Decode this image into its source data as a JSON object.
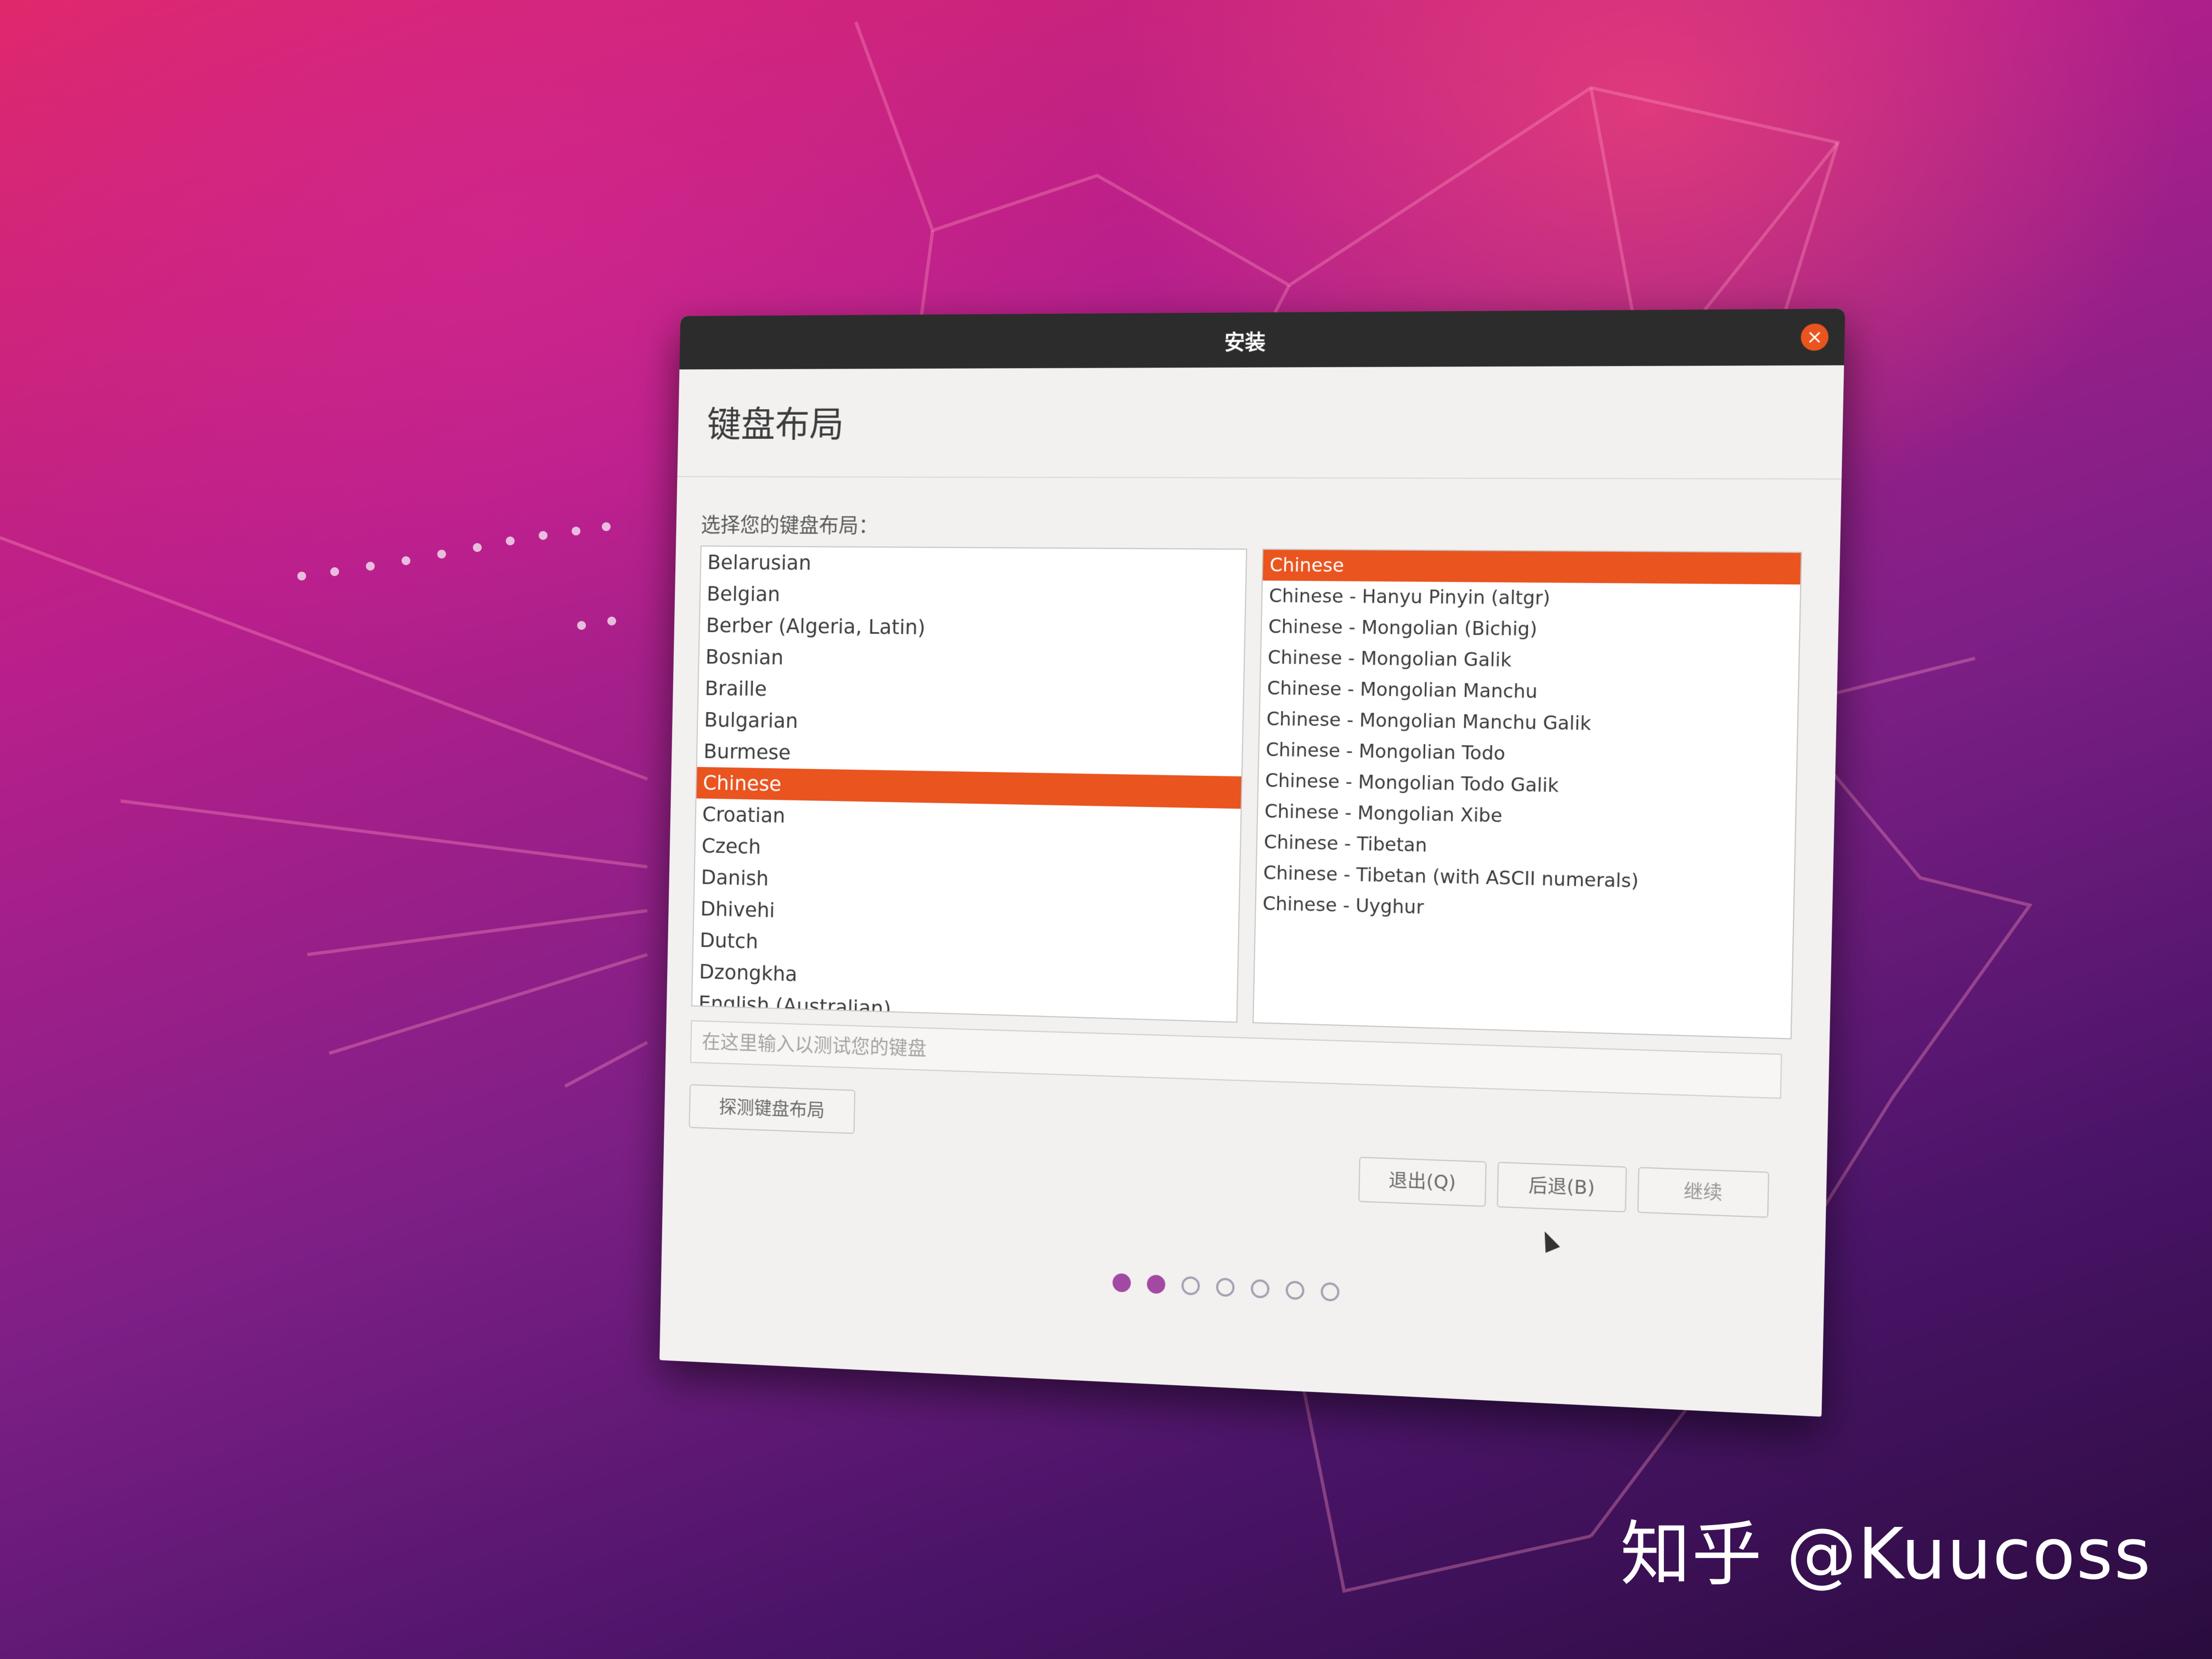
{
  "window": {
    "title": "安装",
    "close_icon": "close-icon"
  },
  "page": {
    "heading": "键盘布局",
    "prompt": "选择您的键盘布局："
  },
  "layouts": {
    "items": [
      {
        "label": "Belarusian",
        "selected": false
      },
      {
        "label": "Belgian",
        "selected": false
      },
      {
        "label": "Berber (Algeria, Latin)",
        "selected": false
      },
      {
        "label": "Bosnian",
        "selected": false
      },
      {
        "label": "Braille",
        "selected": false
      },
      {
        "label": "Bulgarian",
        "selected": false
      },
      {
        "label": "Burmese",
        "selected": false
      },
      {
        "label": "Chinese",
        "selected": true
      },
      {
        "label": "Croatian",
        "selected": false
      },
      {
        "label": "Czech",
        "selected": false
      },
      {
        "label": "Danish",
        "selected": false
      },
      {
        "label": "Dhivehi",
        "selected": false
      },
      {
        "label": "Dutch",
        "selected": false
      },
      {
        "label": "Dzongkha",
        "selected": false
      },
      {
        "label": "English (Australian)",
        "selected": false
      }
    ]
  },
  "variants": {
    "items": [
      {
        "label": "Chinese",
        "selected": true
      },
      {
        "label": "Chinese - Hanyu Pinyin (altgr)",
        "selected": false
      },
      {
        "label": "Chinese - Mongolian (Bichig)",
        "selected": false
      },
      {
        "label": "Chinese - Mongolian Galik",
        "selected": false
      },
      {
        "label": "Chinese - Mongolian Manchu",
        "selected": false
      },
      {
        "label": "Chinese - Mongolian Manchu Galik",
        "selected": false
      },
      {
        "label": "Chinese - Mongolian Todo",
        "selected": false
      },
      {
        "label": "Chinese - Mongolian Todo Galik",
        "selected": false
      },
      {
        "label": "Chinese - Mongolian Xibe",
        "selected": false
      },
      {
        "label": "Chinese - Tibetan",
        "selected": false
      },
      {
        "label": "Chinese - Tibetan (with ASCII numerals)",
        "selected": false
      },
      {
        "label": "Chinese - Uyghur",
        "selected": false
      }
    ]
  },
  "test_field": {
    "placeholder": "在这里输入以测试您的键盘",
    "value": ""
  },
  "buttons": {
    "detect": "探测键盘布局",
    "quit": "退出(Q)",
    "back": "后退(B)",
    "continue": "继续"
  },
  "progress": {
    "total_steps": 7,
    "completed_steps": 2
  },
  "colors": {
    "accent": "#e9541f",
    "titlebar": "#2c2c2c",
    "dot_filled": "#a24aa3"
  },
  "watermark": "知乎 @Kuucoss"
}
